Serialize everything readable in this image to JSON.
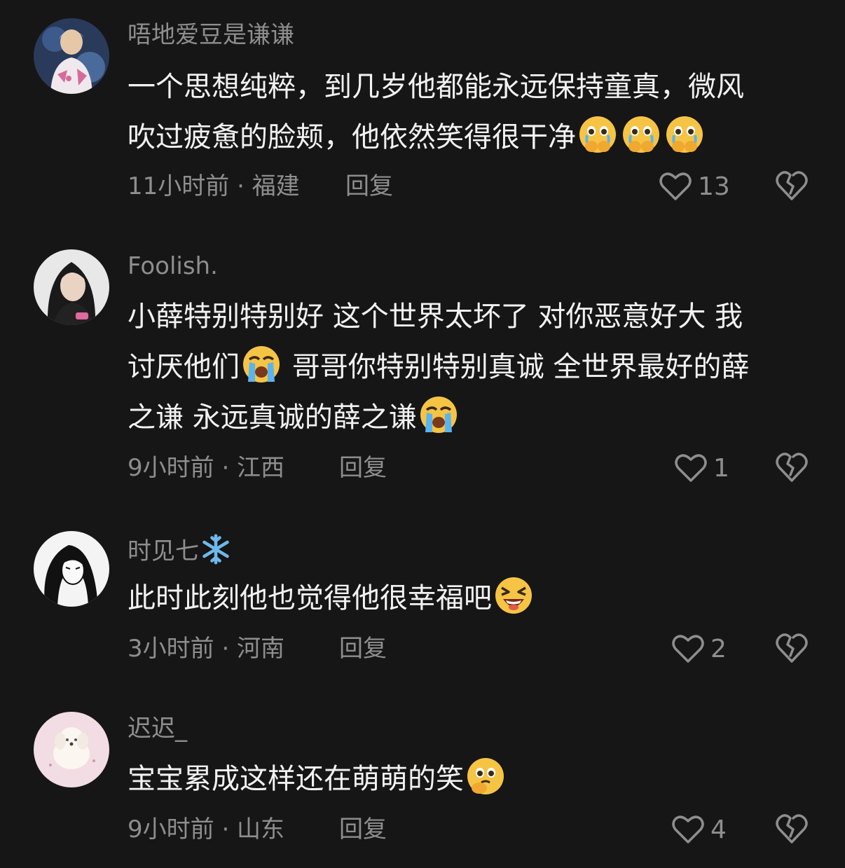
{
  "comments": [
    {
      "username": "唔地爱豆是谦谦",
      "lines": [
        "一个思想纯粹，到几岁他都能永远保持童真，微风",
        "吹过疲惫的脸颊，他依然笑得很干净"
      ],
      "time": "11小时前 · 福建",
      "reply": "回复",
      "likes": "13",
      "avatar_icon": "idol-photo-avatar",
      "emojis": [
        "pleading-face-hands-icon",
        "pleading-face-hands-icon",
        "pleading-face-hands-icon"
      ]
    },
    {
      "username": "Foolish.",
      "lines": [
        "小薛特别特别好 这个世界太坏了 对你恶意好大 我",
        "讨厌他们",
        " 哥哥你特别特别真诚 全世界最好的薛",
        "之谦 永远真诚的薛之谦"
      ],
      "time": "9小时前 · 江西",
      "reply": "回复",
      "likes": "1",
      "avatar_icon": "girl-photo-avatar",
      "emojis": [
        "loudly-crying-face-icon",
        "loudly-crying-face-icon"
      ]
    },
    {
      "username": "时见七",
      "username_emoji": "snowflake-icon",
      "lines": [
        "此时此刻他也觉得他很幸福吧"
      ],
      "time": "3小时前 · 河南",
      "reply": "回复",
      "likes": "2",
      "avatar_icon": "manga-girl-avatar",
      "emojis": [
        "laughing-crying-face-icon"
      ]
    },
    {
      "username": "迟迟_",
      "lines": [
        "宝宝累成这样还在萌萌的笑"
      ],
      "time": "9小时前 · 山东",
      "reply": "回复",
      "likes": "4",
      "avatar_icon": "puppy-avatar",
      "emojis": [
        "pleading-hand-face-icon"
      ]
    }
  ],
  "colors": {
    "background": "#161616",
    "text": "#f2f2f2",
    "secondary": "#8e8e8e"
  }
}
